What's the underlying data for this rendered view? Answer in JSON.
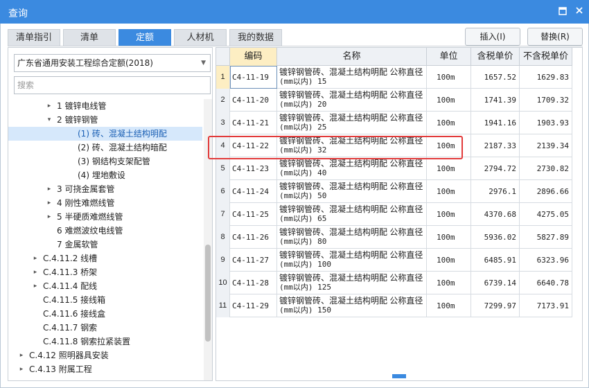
{
  "window": {
    "title": "查询",
    "pin_icon": "pin-icon",
    "close_icon": "close-icon"
  },
  "tabs": [
    {
      "label": "清单指引",
      "active": false
    },
    {
      "label": "清单",
      "active": false
    },
    {
      "label": "定额",
      "active": true
    },
    {
      "label": "人材机",
      "active": false
    },
    {
      "label": "我的数据",
      "active": false
    }
  ],
  "actions": {
    "insert_label": "插入(I)",
    "replace_label": "替换(R)"
  },
  "left": {
    "library": "广东省通用安装工程综合定额(2018)",
    "search_placeholder": "搜索",
    "tree": [
      {
        "label": "1 镀锌电线管",
        "expander": "▸"
      },
      {
        "label": "2 镀锌钢管",
        "expander": "▾"
      },
      {
        "label": "(1) 砖、混凝土结构明配",
        "expander": "",
        "selected": true
      },
      {
        "label": "(2) 砖、混凝土结构暗配",
        "expander": ""
      },
      {
        "label": "(3) 钢结构支架配管",
        "expander": ""
      },
      {
        "label": "(4) 埋地敷设",
        "expander": ""
      },
      {
        "label": "3 可挠金属套管",
        "expander": "▸"
      },
      {
        "label": "4 刚性难燃线管",
        "expander": "▸"
      },
      {
        "label": "5 半硬质难燃线管",
        "expander": "▸"
      },
      {
        "label": "6 难燃波纹电线管",
        "expander": ""
      },
      {
        "label": "7 金属软管",
        "expander": ""
      },
      {
        "label": "C.4.11.2 线槽",
        "expander": "▸"
      },
      {
        "label": "C.4.11.3 桥架",
        "expander": "▸"
      },
      {
        "label": "C.4.11.4 配线",
        "expander": "▸"
      },
      {
        "label": "C.4.11.5 接线箱",
        "expander": ""
      },
      {
        "label": "C.4.11.6 接线盒",
        "expander": ""
      },
      {
        "label": "C.4.11.7 钢索",
        "expander": ""
      },
      {
        "label": "C.4.11.8 钢索拉紧装置",
        "expander": ""
      },
      {
        "label": "C.4.12 照明器具安装",
        "expander": "▸"
      },
      {
        "label": "C.4.13 附属工程",
        "expander": "▸"
      }
    ]
  },
  "grid": {
    "headers": [
      "编码",
      "名称",
      "单位",
      "含税单价",
      "不含税单价"
    ],
    "rows": [
      {
        "idx": "1",
        "code": "C4-11-19",
        "name1": "镀锌钢管砖、混凝土结构明配 公称直径",
        "name2": "(mm以内) 15",
        "unit": "100m",
        "price_tax": "1657.52",
        "price_notax": "1629.83"
      },
      {
        "idx": "2",
        "code": "C4-11-20",
        "name1": "镀锌钢管砖、混凝土结构明配 公称直径",
        "name2": "(mm以内) 20",
        "unit": "100m",
        "price_tax": "1741.39",
        "price_notax": "1709.32"
      },
      {
        "idx": "3",
        "code": "C4-11-21",
        "name1": "镀锌钢管砖、混凝土结构明配 公称直径",
        "name2": "(mm以内) 25",
        "unit": "100m",
        "price_tax": "1941.16",
        "price_notax": "1903.93"
      },
      {
        "idx": "4",
        "code": "C4-11-22",
        "name1": "镀锌钢管砖、混凝土结构明配 公称直径",
        "name2": "(mm以内) 32",
        "unit": "100m",
        "price_tax": "2187.33",
        "price_notax": "2139.34"
      },
      {
        "idx": "5",
        "code": "C4-11-23",
        "name1": "镀锌钢管砖、混凝土结构明配 公称直径",
        "name2": "(mm以内) 40",
        "unit": "100m",
        "price_tax": "2794.72",
        "price_notax": "2730.82"
      },
      {
        "idx": "6",
        "code": "C4-11-24",
        "name1": "镀锌钢管砖、混凝土结构明配 公称直径",
        "name2": "(mm以内) 50",
        "unit": "100m",
        "price_tax": "2976.1",
        "price_notax": "2896.66"
      },
      {
        "idx": "7",
        "code": "C4-11-25",
        "name1": "镀锌钢管砖、混凝土结构明配 公称直径",
        "name2": "(mm以内) 65",
        "unit": "100m",
        "price_tax": "4370.68",
        "price_notax": "4275.05"
      },
      {
        "idx": "8",
        "code": "C4-11-26",
        "name1": "镀锌钢管砖、混凝土结构明配 公称直径",
        "name2": "(mm以内) 80",
        "unit": "100m",
        "price_tax": "5936.02",
        "price_notax": "5827.89"
      },
      {
        "idx": "9",
        "code": "C4-11-27",
        "name1": "镀锌钢管砖、混凝土结构明配 公称直径",
        "name2": "(mm以内) 100",
        "unit": "100m",
        "price_tax": "6485.91",
        "price_notax": "6323.96"
      },
      {
        "idx": "10",
        "code": "C4-11-28",
        "name1": "镀锌钢管砖、混凝土结构明配 公称直径",
        "name2": "(mm以内) 125",
        "unit": "100m",
        "price_tax": "6739.14",
        "price_notax": "6640.78"
      },
      {
        "idx": "11",
        "code": "C4-11-29",
        "name1": "镀锌钢管砖、混凝土结构明配 公称直径",
        "name2": "(mm以内) 150",
        "unit": "100m",
        "price_tax": "7299.97",
        "price_notax": "7173.91"
      }
    ]
  },
  "colors": {
    "accent": "#3b8ae0",
    "highlight": "#e23a3a",
    "header_highlight": "#fdeec3"
  }
}
